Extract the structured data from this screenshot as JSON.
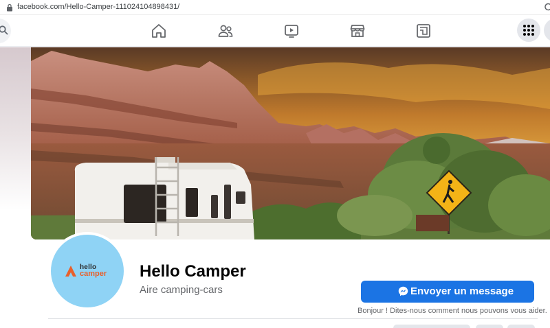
{
  "browser": {
    "url": "facebook.com/Hello-Camper-111024104898431/"
  },
  "nav": {
    "icons": [
      "search-icon",
      "home-icon",
      "friends-icon",
      "watch-icon",
      "marketplace-icon",
      "groups-icon",
      "menu-grid-icon"
    ]
  },
  "page": {
    "name": "Hello Camper",
    "category": "Aire camping-cars",
    "avatar_logo": {
      "line1": "hello",
      "line2": "camper"
    },
    "message_button": "Envoyer un message",
    "message_hint": "Bonjour ! Dites-nous comment nous pouvons vous aider."
  },
  "colors": {
    "accent": "#1b74e4",
    "avatar_bg": "#8fd3f5",
    "logo_orange": "#e8602c"
  }
}
